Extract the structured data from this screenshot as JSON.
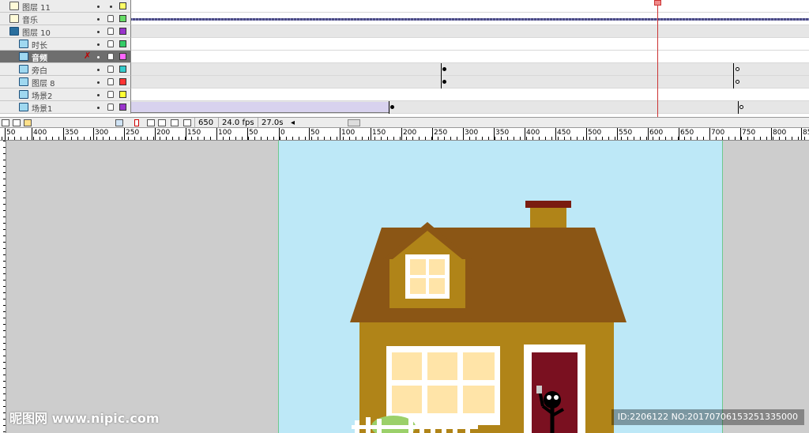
{
  "layers": [
    {
      "name": "图层 11",
      "type": "note",
      "color": "#ffff66",
      "locked": false
    },
    {
      "name": "音乐",
      "type": "note",
      "color": "#66dd66",
      "locked": true,
      "audio": true
    },
    {
      "name": "图层 10",
      "type": "folder",
      "color": "#9933cc",
      "locked": true
    },
    {
      "name": "时长",
      "type": "layer",
      "color": "#33cc66",
      "locked": true
    },
    {
      "name": "音频",
      "type": "layer",
      "color": "#ff66ff",
      "locked": true,
      "selected": true
    },
    {
      "name": "旁白",
      "type": "layer",
      "color": "#33cccc",
      "locked": true
    },
    {
      "name": "图层 8",
      "type": "layer",
      "color": "#ff3333",
      "locked": true
    },
    {
      "name": "场景2",
      "type": "layer",
      "color": "#ffff33",
      "locked": true
    },
    {
      "name": "场景1",
      "type": "layer",
      "color": "#9933cc",
      "locked": true
    }
  ],
  "timeline_bar": {
    "current_frame": "650",
    "frame_rate": "24.0 fps",
    "elapsed_time": "27.0s"
  },
  "ruler": {
    "labels": [
      "50",
      "400",
      "350",
      "300",
      "250",
      "200",
      "150",
      "100",
      "50",
      "0",
      "50",
      "100",
      "150",
      "200",
      "250",
      "300",
      "350",
      "400",
      "450",
      "500",
      "550",
      "600",
      "650",
      "700",
      "750",
      "800",
      "85"
    ]
  },
  "colors": {
    "sky": "#bde8f7",
    "roof": "#8b5615",
    "wall": "#b08418",
    "window": "#ffe4a8",
    "door": "#7a1020",
    "chimney_cap": "#7a1c10"
  },
  "watermark": {
    "brand": "昵图网 www.nipic.com",
    "id_text": "ID:2206122 NO:20170706153251335000"
  }
}
